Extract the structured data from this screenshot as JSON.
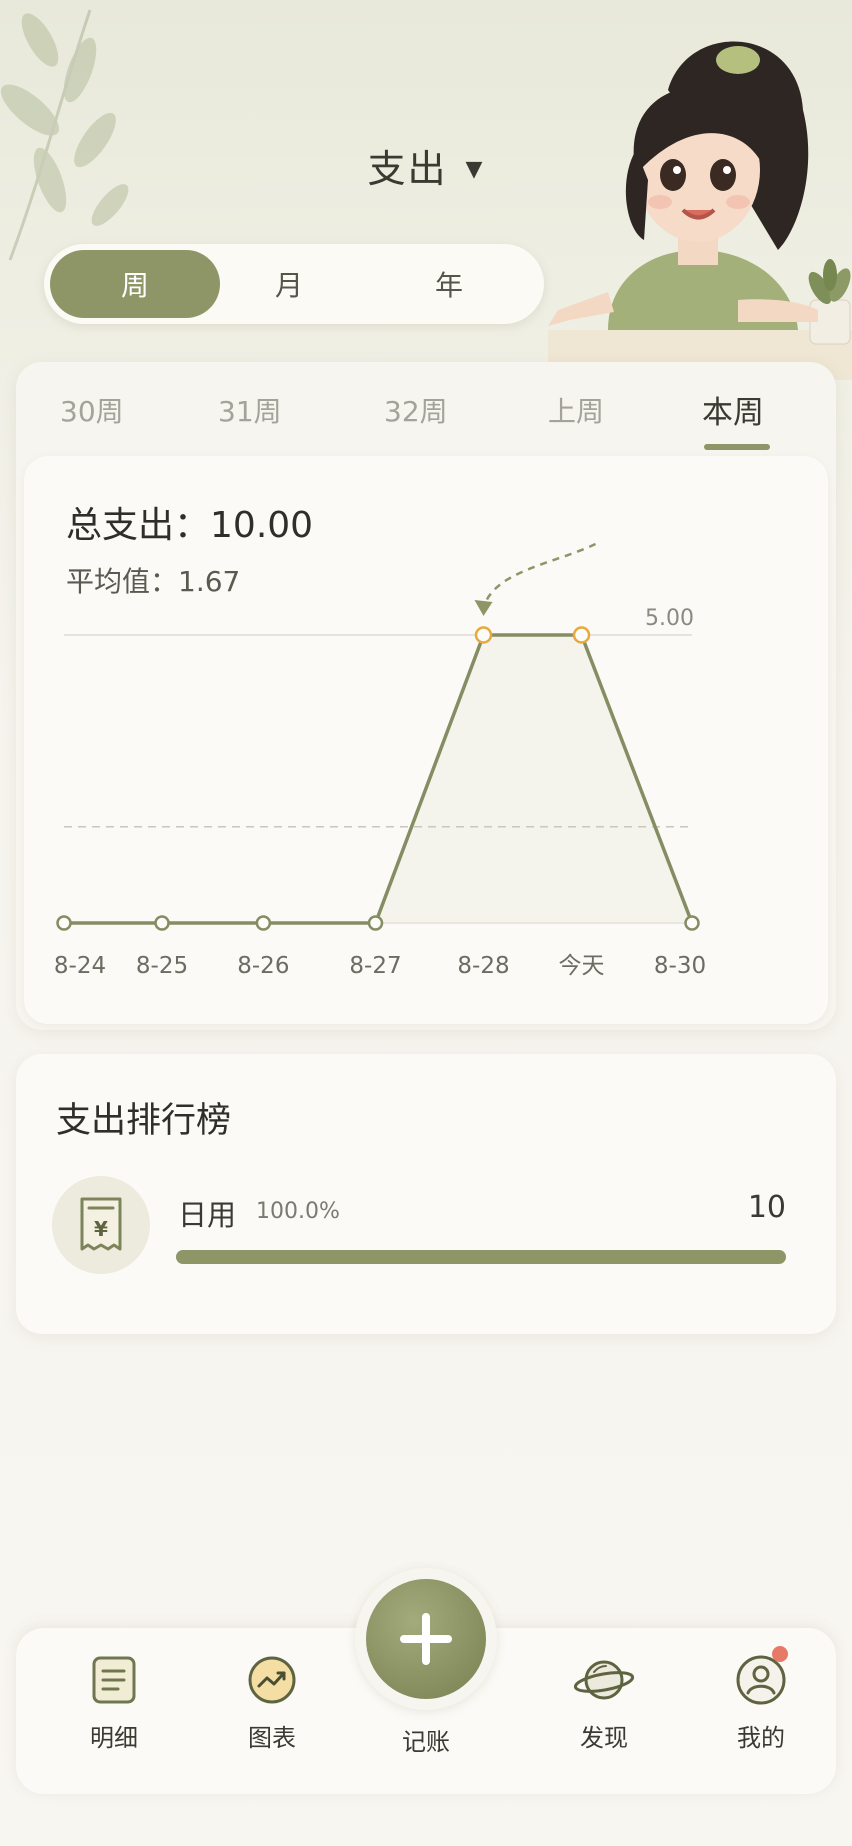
{
  "header": {
    "title": "支出",
    "caret": "▼"
  },
  "period_tabs": [
    {
      "label": "周",
      "active": true
    },
    {
      "label": "月",
      "active": false
    },
    {
      "label": "年",
      "active": false
    }
  ],
  "week_tabs": [
    {
      "label": "30周",
      "active": false
    },
    {
      "label": "31周",
      "active": false
    },
    {
      "label": "32周",
      "active": false
    },
    {
      "label": "上周",
      "active": false
    },
    {
      "label": "本周",
      "active": true
    }
  ],
  "summary": {
    "total_label": "总支出：",
    "total_value": "10.00",
    "avg_label": "平均值：",
    "avg_value": "1.67"
  },
  "chart_data": {
    "type": "line",
    "categories": [
      "8-24",
      "8-25",
      "8-26",
      "8-27",
      "8-28",
      "今天",
      "8-30"
    ],
    "values": [
      0,
      0,
      0,
      0,
      5,
      5,
      0
    ],
    "max_label": "5.00",
    "ylim": [
      0,
      5
    ],
    "average_line": 1.67,
    "highlighted": [
      "8-28",
      "今天"
    ],
    "line_color": "#858d63",
    "highlight_color": "#e7a93d"
  },
  "ranking": {
    "title": "支出排行榜",
    "items": [
      {
        "icon": "receipt-yen-icon",
        "name": "日用",
        "percent": "100.0%",
        "amount": "10",
        "fraction": 1.0
      }
    ]
  },
  "nav": {
    "items": [
      {
        "label": "明细",
        "icon": "list-icon"
      },
      {
        "label": "图表",
        "icon": "chart-icon"
      },
      {
        "label": "记账",
        "icon": "plus-icon"
      },
      {
        "label": "发现",
        "icon": "planet-icon"
      },
      {
        "label": "我的",
        "icon": "profile-icon"
      }
    ]
  },
  "colors": {
    "accent": "#8e9668",
    "background": "#f6f4ee",
    "badge": "#e77a66"
  }
}
